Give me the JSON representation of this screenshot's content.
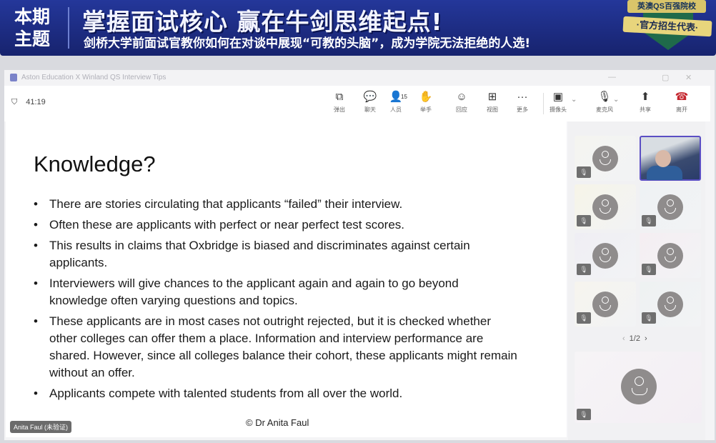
{
  "banner": {
    "side_line1": "本期",
    "side_line2": "主题",
    "headline": "掌握面试核心  赢在牛剑思维起点!",
    "subline": "剑桥大学前面试官教你如何在对谈中展现“可教的头脑”，成为学院无法拒绝的人选!",
    "badge_top": "英澳QS百强院校",
    "badge_main": "·官方招生代表·"
  },
  "window": {
    "title": "Aston Education X Winland QS Interview Tips",
    "timer": "41:19"
  },
  "toolbar": [
    {
      "icon": "popout-icon",
      "glyph": "⧉",
      "label": "弹出"
    },
    {
      "icon": "chat-icon",
      "glyph": "💬",
      "label": "聊天"
    },
    {
      "icon": "people-icon",
      "glyph": "👤",
      "label": "人员",
      "count": "15"
    },
    {
      "icon": "raise-hand-icon",
      "glyph": "✋",
      "label": "举手"
    },
    {
      "icon": "react-icon",
      "glyph": "☺",
      "label": "回应"
    },
    {
      "icon": "view-icon",
      "glyph": "⊞",
      "label": "视图"
    },
    {
      "icon": "more-icon",
      "glyph": "···",
      "label": "更多"
    },
    {
      "icon": "camera-off-icon",
      "glyph": "▣",
      "label": "摄像头"
    },
    {
      "icon": "mic-off-icon",
      "glyph": "🎙",
      "label": "麦克风"
    },
    {
      "icon": "share-icon",
      "glyph": "⬆",
      "label": "共享"
    },
    {
      "icon": "leave-icon",
      "glyph": "☎",
      "label": "离开"
    }
  ],
  "slide": {
    "title": "Knowledge?",
    "bullets": [
      "There are stories circulating that applicants “failed” their interview.",
      "Often these are applicants with perfect or near perfect test scores.",
      "This results in claims that Oxbridge is biased and discriminates against certain applicants.",
      "Interviewers will give chances to the applicant again and again to go beyond knowledge often varying questions and topics.",
      "These applicants are in most cases not outright rejected, but it is checked whether other colleges can offer them a place. Information and interview performance are shared. However, since all colleges balance their cohort, these applicants might remain without an offer.",
      "Applicants compete with talented students from all over the world."
    ],
    "copyright": "© Dr Anita Faul",
    "speaker_tag": "Anita Faul (未验证)"
  },
  "gallery": {
    "page": "1/2"
  },
  "colors": {
    "banner": "#1d2b84",
    "leave": "#c4262e",
    "active_border": "#5b4fc4"
  }
}
